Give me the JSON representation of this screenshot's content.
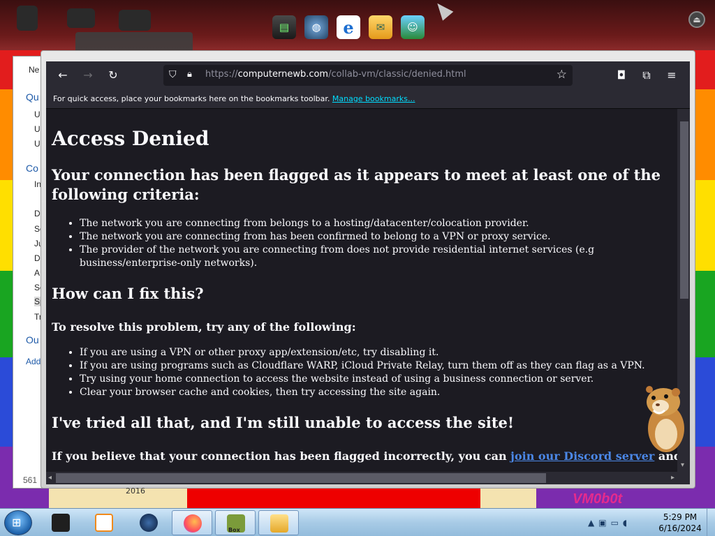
{
  "browser": {
    "url_prefix": "https://",
    "url_host": "computernewb.com",
    "url_path": "/collab-vm/classic/denied.html",
    "bookmarks_message": "For quick access, place your bookmarks here on the bookmarks toolbar.",
    "manage_bookmarks": "Manage bookmarks..."
  },
  "page": {
    "title": "Access Denied",
    "flagged_heading": "Your connection has been flagged as it appears to meet at least one of the following criteria:",
    "criteria": [
      "The network you are connecting from belongs to a hosting/datacenter/colocation provider.",
      "The network you are connecting from has been confirmed to belong to a VPN or proxy service.",
      "The provider of the network you are connecting from does not provide residential internet services (e.g business/enterprise-only networks)."
    ],
    "fix_heading": "How can I fix this?",
    "resolve_heading": "To resolve this problem, try any of the following:",
    "fixes": [
      "If you are using a VPN or other proxy app/extension/etc, try disabling it.",
      "If you are using programs such as Cloudflare WARP, iCloud Private Relay, turn them off as they can flag as a VPN.",
      "Try using your home connection to access the website instead of using a business connection or server.",
      "Clear your browser cache and cookies, then try accessing the site again."
    ],
    "tried_heading": "I've tried all that, and I'm still unable to access the site!",
    "discord_prefix": "If you believe that your connection has been flagged incorrectly, you can ",
    "discord_link": "join our Discord server",
    "discord_suffix": " and open a ticket."
  },
  "background_window": {
    "items": [
      "Ne",
      "Qu",
      "U",
      "U",
      "U",
      "Co",
      "In",
      "D",
      "Se",
      "Ju",
      "D",
      "A",
      "Se",
      "Sp",
      "Tr",
      "Ou",
      "Add"
    ],
    "status": "561"
  },
  "wallpaper": {
    "year": "2016",
    "vm_label": "VM0b0t"
  },
  "taskbar": {
    "box_label": "Box",
    "time": "5:29 PM",
    "date": "6/16/2024"
  },
  "colors": {
    "rainbow": [
      "#e21d1d",
      "#ff8c00",
      "#ffdf00",
      "#19a521",
      "#2b4bd8",
      "#7b2cae"
    ],
    "page_bg": "#1c1b22",
    "toolbar_bg": "#2b2a33",
    "link": "#4b87e6"
  }
}
